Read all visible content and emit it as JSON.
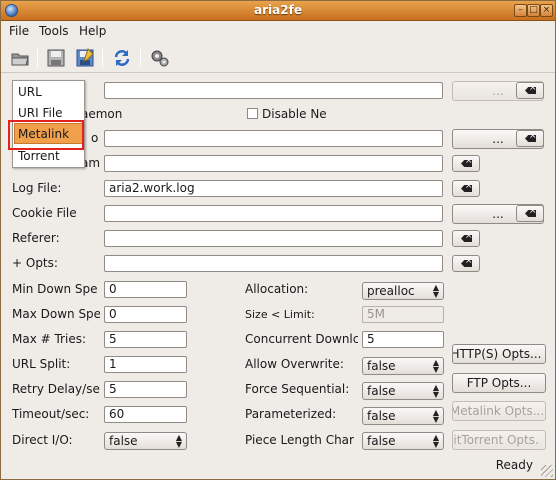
{
  "window": {
    "title": "aria2fe"
  },
  "menubar": [
    "File",
    "Tools",
    "Help"
  ],
  "toolbar_icons": [
    "open-icon",
    "save-icon",
    "save-as-icon",
    "refresh-icon",
    "settings-icon"
  ],
  "dropdown": {
    "items": [
      "URL",
      "URI File",
      "Metalink",
      "Torrent"
    ],
    "selected": "Metalink"
  },
  "top": {
    "browse_label": "...",
    "daemon_label_partial": "aemon",
    "disable_label": "Disable Ne",
    "partial_to": "o",
    "partial_am": "am"
  },
  "fields": {
    "log_file_label": "Log File:",
    "log_file_value": "aria2.work.log",
    "cookie_file_label": "Cookie File",
    "referer_label": "Referer:",
    "opts_label": "+ Opts:"
  },
  "left": [
    {
      "label": "Min Down Spe",
      "value": "0"
    },
    {
      "label": "Max Down Spe",
      "value": "0"
    },
    {
      "label": "Max # Tries:",
      "value": "5"
    },
    {
      "label": "URL Split:",
      "value": "1"
    },
    {
      "label": "Retry Delay/se",
      "value": "5"
    },
    {
      "label": "Timeout/sec:",
      "value": "60"
    },
    {
      "label": "Direct I/O:",
      "value": "false"
    }
  ],
  "middle": [
    {
      "label": "Allocation:",
      "value": "prealloc"
    },
    {
      "label": "Size < Limit:",
      "value": "5M"
    },
    {
      "label": "Concurrent Downlc",
      "value": "5"
    },
    {
      "label": "Allow Overwrite:",
      "value": "false"
    },
    {
      "label": "Force Sequential:",
      "value": "false"
    },
    {
      "label": "Parameterized:",
      "value": "false"
    },
    {
      "label": "Piece Length Char",
      "value": "false"
    }
  ],
  "right_buttons": [
    "HTTP(S) Opts...",
    "FTP Opts...",
    "Metalink Opts...",
    "BitTorrent Opts."
  ],
  "status": "Ready"
}
